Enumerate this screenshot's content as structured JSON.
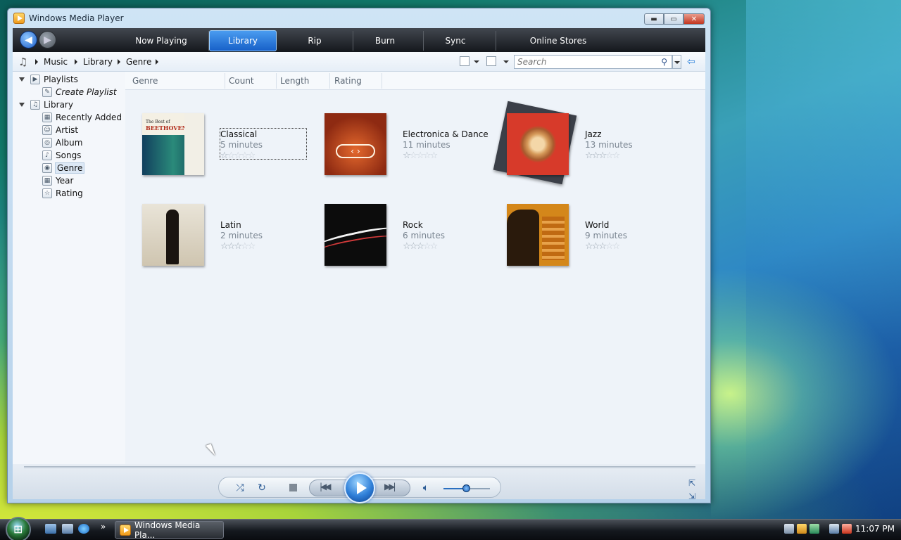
{
  "window": {
    "title": "Windows Media Player",
    "minimize_glyph": "▬",
    "maximize_glyph": "▭",
    "close_glyph": "✕"
  },
  "nav": {
    "tabs": [
      {
        "label": "Now Playing"
      },
      {
        "label": "Library"
      },
      {
        "label": "Rip"
      },
      {
        "label": "Burn"
      },
      {
        "label": "Sync"
      },
      {
        "label": "Online Stores"
      }
    ],
    "active_tab": "Library"
  },
  "breadcrumb": [
    "Music",
    "Library",
    "Genre"
  ],
  "search": {
    "placeholder": "Search"
  },
  "tree": {
    "playlists_label": "Playlists",
    "create_playlist_label": "Create Playlist",
    "library_label": "Library",
    "items": [
      {
        "label": "Recently Added"
      },
      {
        "label": "Artist"
      },
      {
        "label": "Album"
      },
      {
        "label": "Songs"
      },
      {
        "label": "Genre"
      },
      {
        "label": "Year"
      },
      {
        "label": "Rating"
      }
    ],
    "selected": "Genre"
  },
  "columns": [
    "Genre",
    "Count",
    "Length",
    "Rating"
  ],
  "genres": [
    {
      "name": "Classical",
      "length": "5 minutes",
      "rating": 1
    },
    {
      "name": "Electronica & Dance",
      "length": "11 minutes",
      "rating": 1
    },
    {
      "name": "Jazz",
      "length": "13 minutes",
      "rating": 3
    },
    {
      "name": "Latin",
      "length": "2 minutes",
      "rating": 3
    },
    {
      "name": "Rock",
      "length": "6 minutes",
      "rating": 3
    },
    {
      "name": "World",
      "length": "9 minutes",
      "rating": 3
    }
  ],
  "album_art_text": {
    "classical_line1": "The Best of",
    "classical_line2": "BEETHOVEN"
  },
  "taskbar": {
    "task_label": "Windows Media Pla...",
    "clock": "11:07 PM",
    "quicklaunch_more": "»"
  },
  "colors": {
    "accent": "#1e78d8",
    "active_tab": "#2f7fd8",
    "navbar": "#14171c"
  }
}
